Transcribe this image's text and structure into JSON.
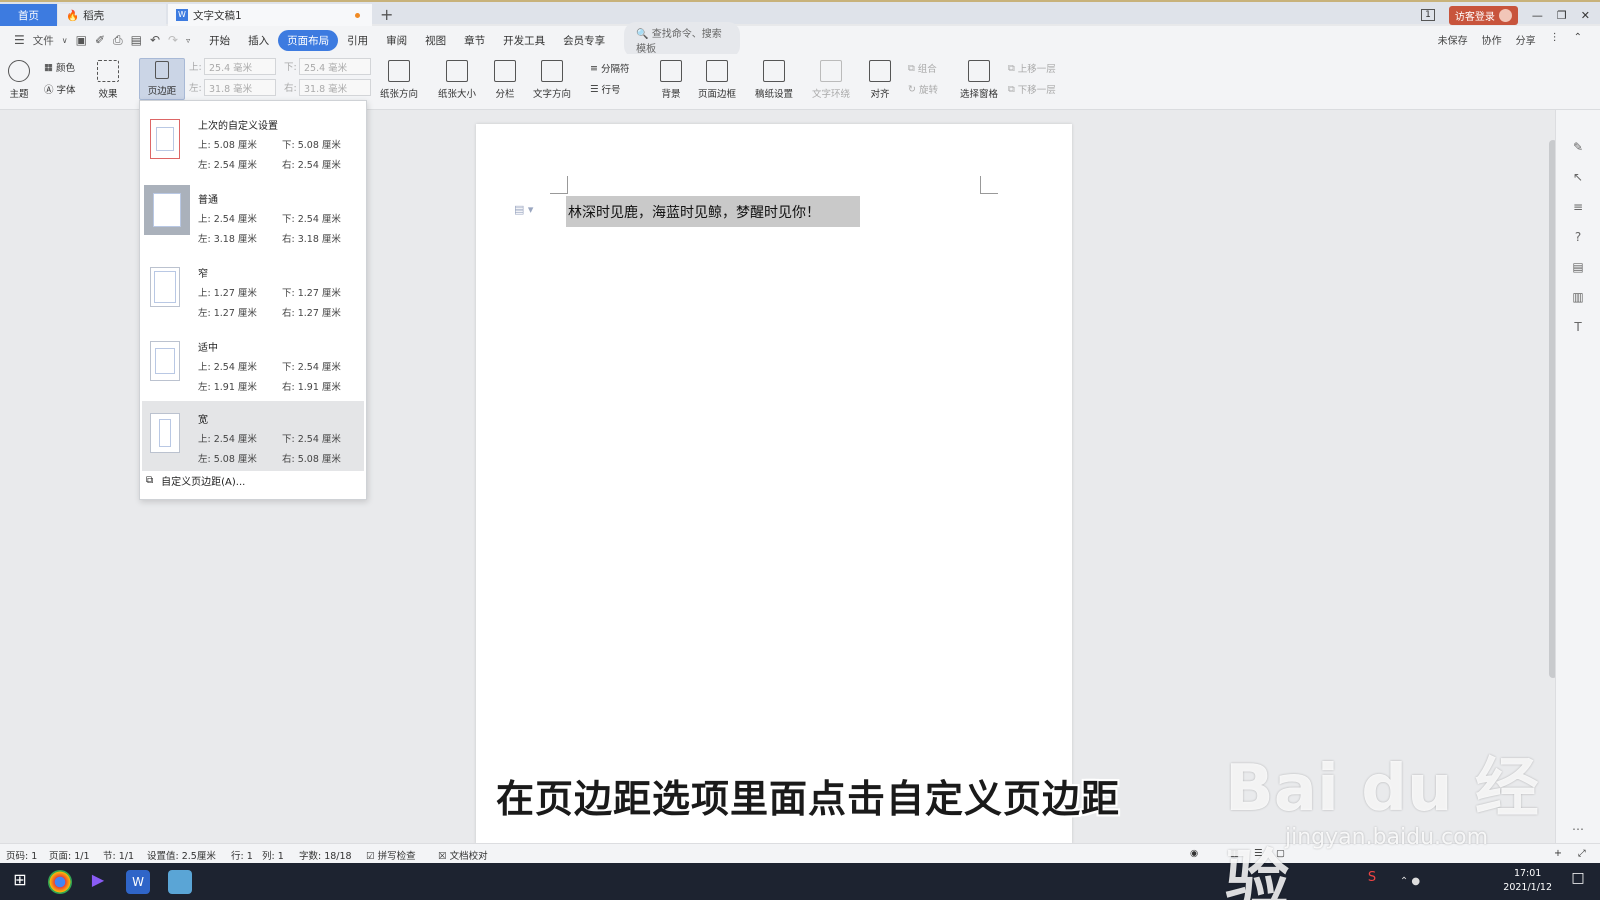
{
  "tabs": {
    "home": "首页",
    "daoke": "稻壳",
    "doc": "文字文稿1",
    "new_tab": "+"
  },
  "window": {
    "page_count_icon": "1",
    "login": "访客登录"
  },
  "menu": {
    "file": "文件",
    "items": [
      "开始",
      "插入",
      "页面布局",
      "引用",
      "审阅",
      "视图",
      "章节",
      "开发工具",
      "会员专享"
    ],
    "active_index": 2,
    "search_placeholder": "查找命令、搜索模板",
    "right": [
      "未保存",
      "协作",
      "分享"
    ]
  },
  "ribbon": {
    "theme": "主题",
    "color": "颜色",
    "font": "字体",
    "effect": "效果",
    "margin": "页边距",
    "top_label": "上:",
    "top_value": "25.4 毫米",
    "bottom_label": "下:",
    "bottom_value": "25.4 毫米",
    "left_label": "左:",
    "left_value": "31.8 毫米",
    "right_label": "右:",
    "right_value": "31.8 毫米",
    "orientation": "纸张方向",
    "size": "纸张大小",
    "columns": "分栏",
    "text_direction": "文字方向",
    "separator": "分隔符",
    "line_number": "行号",
    "background": "背景",
    "page_border": "页面边框",
    "paper_setup": "稿纸设置",
    "text_wrap": "文字环绕",
    "align": "对齐",
    "group": "组合",
    "rotate": "旋转",
    "selection_pane": "选择窗格",
    "bring_forward": "上移一层",
    "send_backward": "下移一层"
  },
  "dropdown": {
    "options": [
      {
        "name": "上次的自定义设置",
        "top": "上: 5.08 厘米",
        "bottom": "下: 5.08 厘米",
        "left": "左: 2.54 厘米",
        "right": "右: 2.54 厘米"
      },
      {
        "name": "普通",
        "top": "上: 2.54 厘米",
        "bottom": "下: 2.54 厘米",
        "left": "左: 3.18 厘米",
        "right": "右: 3.18 厘米"
      },
      {
        "name": "窄",
        "top": "上: 1.27 厘米",
        "bottom": "下: 1.27 厘米",
        "left": "左: 1.27 厘米",
        "right": "右: 1.27 厘米"
      },
      {
        "name": "适中",
        "top": "上: 2.54 厘米",
        "bottom": "下: 2.54 厘米",
        "left": "左: 1.91 厘米",
        "right": "右: 1.91 厘米"
      },
      {
        "name": "宽",
        "top": "上: 2.54 厘米",
        "bottom": "下: 2.54 厘米",
        "left": "左: 5.08 厘米",
        "right": "右: 5.08 厘米"
      }
    ],
    "custom": "自定义页边距(A)..."
  },
  "document": {
    "text": "林深时见鹿，海蓝时见鲸，梦醒时见你！"
  },
  "status": {
    "page_no": "页码: 1",
    "pages": "页面: 1/1",
    "section": "节: 1/1",
    "setting": "设置值: 2.5厘米",
    "row": "行: 1",
    "col": "列: 1",
    "words": "字数: 18/18",
    "spell": "拼写检查",
    "proof": "文档校对"
  },
  "taskbar": {
    "time": "17:01",
    "date": "2021/1/12"
  },
  "overlay": {
    "caption": "在页边距选项里面点击自定义页边距",
    "watermark": "Bai du 经验",
    "watermark_url": "jingyan.baidu.com"
  }
}
